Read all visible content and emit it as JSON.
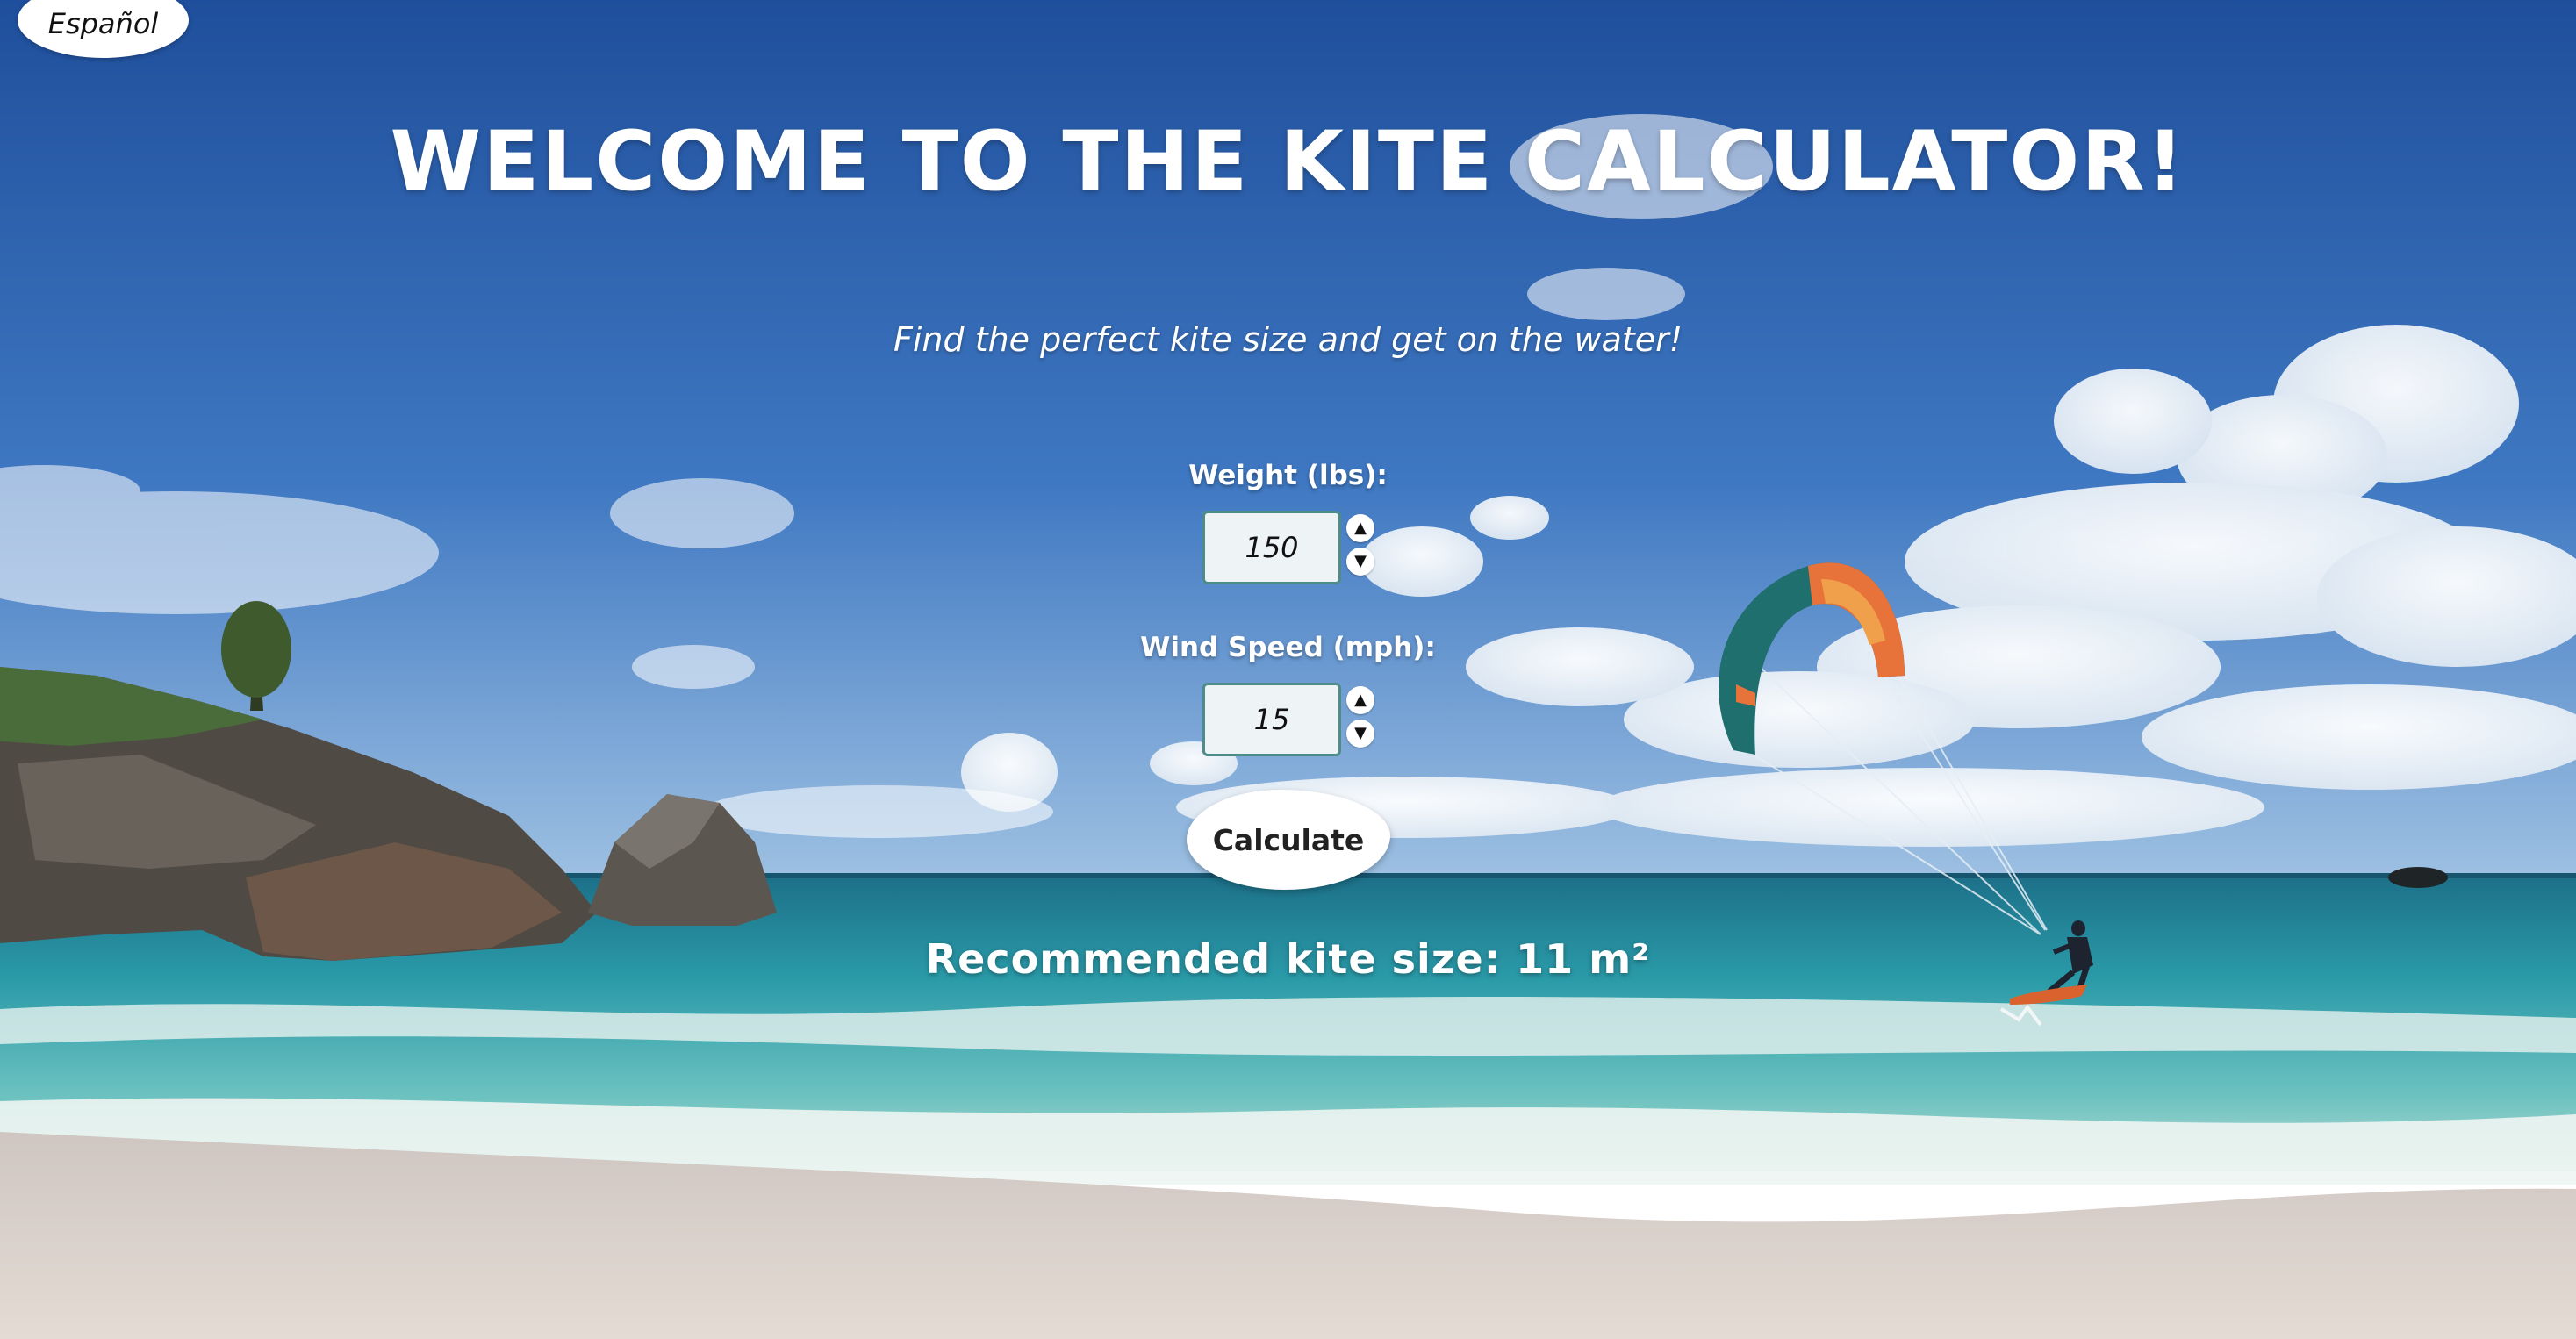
{
  "language_toggle": {
    "label": "Español"
  },
  "header": {
    "title": "WELCOME TO THE KITE CALCULATOR!",
    "subtitle": "Find the perfect kite size and get on the water!"
  },
  "form": {
    "weight": {
      "label": "Weight (lbs):",
      "value": "150"
    },
    "wind_speed": {
      "label": "Wind Speed (mph):",
      "value": "15"
    },
    "stepper_up": "▲",
    "stepper_down": "▼",
    "calculate_label": "Calculate"
  },
  "result": {
    "text": "Recommended kite size: 11 m²"
  },
  "colors": {
    "sky_top": "#1f4f9c",
    "sky_horizon": "#8fb6dc",
    "ocean": "#2a9aa8",
    "sand": "#d9cfc9",
    "input_border": "#4d8c88"
  },
  "icons": [
    "arrow-up-icon",
    "arrow-down-icon"
  ]
}
